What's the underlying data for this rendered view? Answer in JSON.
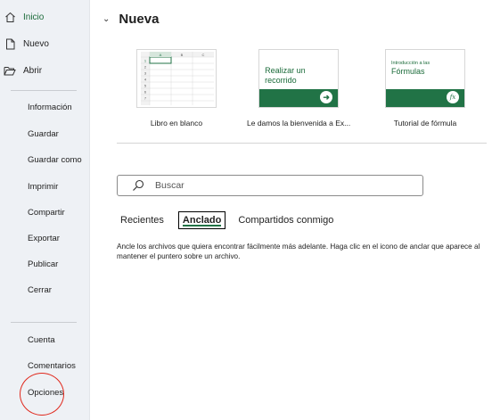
{
  "sidebar": {
    "top_items": [
      {
        "label": "Inicio",
        "icon": "home-icon"
      },
      {
        "label": "Nuevo",
        "icon": "new-document-icon"
      },
      {
        "label": "Abrir",
        "icon": "folder-open-icon"
      }
    ],
    "middle_items": [
      "Información",
      "Guardar",
      "Guardar como",
      "Imprimir",
      "Compartir",
      "Exportar",
      "Publicar",
      "Cerrar"
    ],
    "bottom_items": [
      "Cuenta",
      "Comentarios",
      "Opciones"
    ]
  },
  "main": {
    "title": "Nueva",
    "templates": [
      {
        "caption": "Libro en blanco"
      },
      {
        "caption": "Le damos la bienvenida a Ex...",
        "thumb_text": "Realizar un recorrido"
      },
      {
        "caption": "Tutorial de fórmula",
        "thumb_sub": "Introducción a las",
        "thumb_title": "Fórmulas",
        "fx": "fx"
      }
    ],
    "search": {
      "placeholder": "Buscar"
    },
    "tabs": [
      "Recientes",
      "Anclado",
      "Compartidos conmigo"
    ],
    "active_tab": "Anclado",
    "pinned_description": "Ancle los archivos que quiera encontrar fácilmente más adelante. Haga clic en el icono de anclar que aparece al mantener el puntero sobre un archivo."
  },
  "grid_preview": {
    "columns": [
      "A",
      "B",
      "C"
    ],
    "rows": [
      "1",
      "2",
      "3",
      "4",
      "5",
      "6",
      "7"
    ]
  },
  "colors": {
    "accent": "#217346",
    "highlight": "#e0281c"
  }
}
